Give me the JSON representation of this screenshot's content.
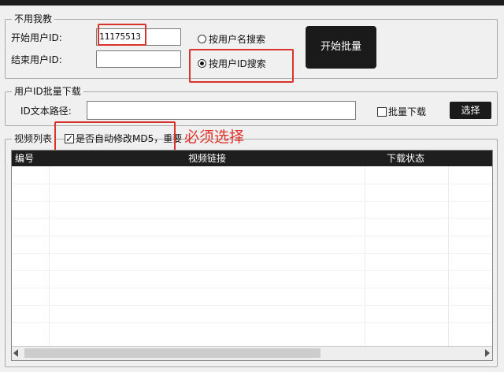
{
  "group1": {
    "legend": "不用我教",
    "start_id_label": "开始用户ID:",
    "start_id_value": "11175513",
    "end_id_label": "结束用户ID:",
    "end_id_value": "",
    "radio_username": "按用户名搜索",
    "radio_userid": "按用户ID搜索",
    "selected_radio": "按用户ID搜索",
    "start_batch_button": "开始批量"
  },
  "group2": {
    "legend": "用户ID批量下载",
    "path_label": "ID文本路径:",
    "path_value": "",
    "batch_download_checkbox": "批量下载",
    "batch_download_checked": false,
    "select_button": "选择"
  },
  "group3": {
    "legend": "视频列表",
    "auto_md5_checkbox": "是否自动修改MD5，重要",
    "auto_md5_checked": true,
    "annotation": "必须选择",
    "columns": [
      "编号",
      "视频链接",
      "下载状态"
    ]
  },
  "colors": {
    "annotation_red": "#d9342b",
    "dark_button": "#1a1a1a",
    "header_bg": "#1e1e1e"
  }
}
